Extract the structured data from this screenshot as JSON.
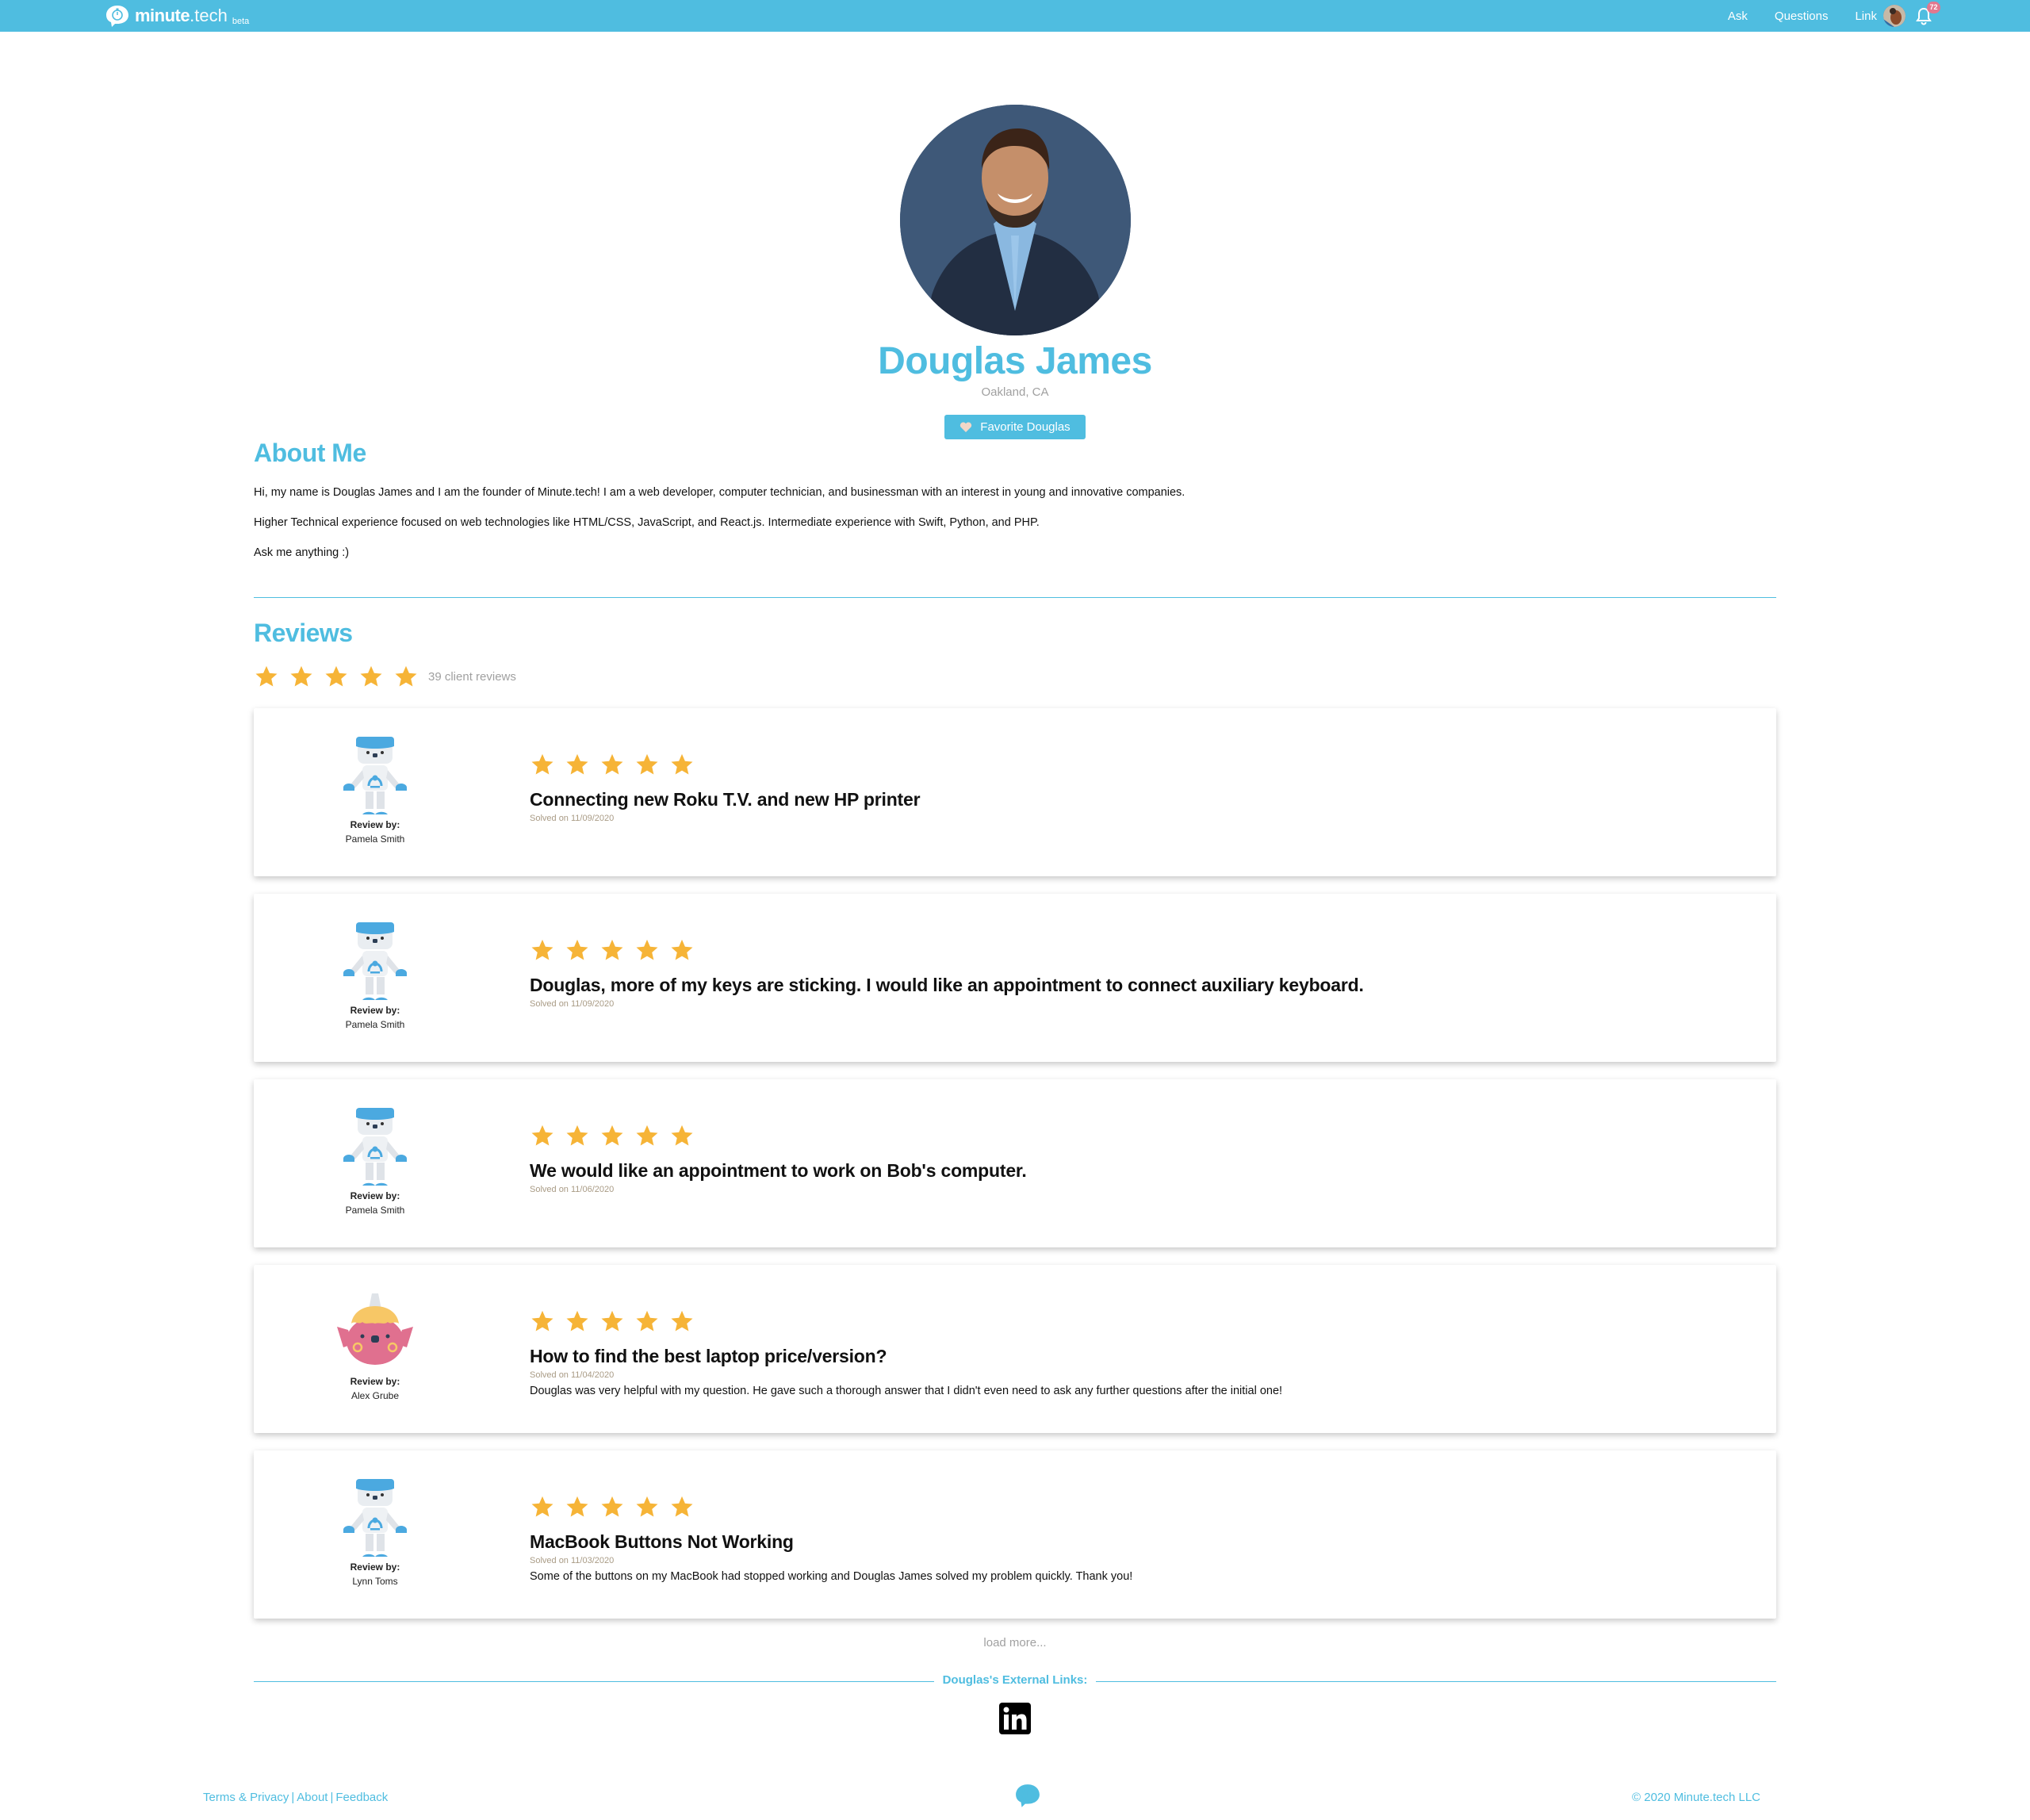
{
  "colors": {
    "brand": "#4fbde0",
    "star": "#f6b437",
    "muted": "#a0a0a0",
    "badge": "#e2788f"
  },
  "navbar": {
    "brand_bold": "minute",
    "brand_light": ".tech",
    "brand_tag": "beta",
    "links": [
      {
        "label": "Ask"
      },
      {
        "label": "Questions"
      },
      {
        "label": "Link"
      }
    ],
    "notification_count": "72",
    "icons": {
      "logo": "brain-stopwatch-icon",
      "avatar": "user-avatar",
      "bell": "bell-icon"
    }
  },
  "profile": {
    "name": "Douglas James",
    "location": "Oakland, CA",
    "favorite_label": "Favorite Douglas",
    "favorite_icon": "heart-icon"
  },
  "about": {
    "title": "About Me",
    "paragraphs": [
      "Hi, my name is Douglas James and I am the founder of Minute.tech! I am a web developer, computer technician, and businessman with an interest in young and innovative companies.",
      "Higher Technical experience focused on web technologies like HTML/CSS, JavaScript, and React.js. Intermediate experience with Swift, Python, and PHP.",
      "Ask me anything :)"
    ]
  },
  "reviews": {
    "title": "Reviews",
    "rating": 5,
    "rating_max": 5,
    "count_label": "39 client reviews",
    "review_by_label": "Review by:",
    "items": [
      {
        "reviewer": "Pamela Smith",
        "avatar": "robot-avatar",
        "rating": 5,
        "title": "Connecting new Roku T.V. and new HP printer",
        "date": "Solved on 11/09/2020",
        "text": ""
      },
      {
        "reviewer": "Pamela Smith",
        "avatar": "robot-avatar",
        "rating": 5,
        "title": "Douglas, more of my keys are sticking. I would like an appointment to connect auxiliary keyboard.",
        "date": "Solved on 11/09/2020",
        "text": ""
      },
      {
        "reviewer": "Pamela Smith",
        "avatar": "robot-avatar",
        "rating": 5,
        "title": "We would like an appointment to work on Bob's computer.",
        "date": "Solved on 11/06/2020",
        "text": ""
      },
      {
        "reviewer": "Alex Grube",
        "avatar": "pink-monster-avatar",
        "rating": 5,
        "title": "How to find the best laptop price/version?",
        "date": "Solved on 11/04/2020",
        "text": "Douglas was very helpful with my question. He gave such a thorough answer that I didn't even need to ask any further questions after the initial one!"
      },
      {
        "reviewer": "Lynn Toms",
        "avatar": "robot-avatar",
        "rating": 5,
        "title": "MacBook Buttons Not Working",
        "date": "Solved on 11/03/2020",
        "text": "Some of the buttons on my MacBook had stopped working and Douglas James solved my problem quickly. Thank you!"
      }
    ],
    "load_more_label": "load more..."
  },
  "external_links": {
    "title": "Douglas's External Links:",
    "items": [
      {
        "name": "LinkedIn",
        "icon": "linkedin-icon"
      }
    ]
  },
  "footer": {
    "links": [
      {
        "label": "Terms & Privacy"
      },
      {
        "label": "About"
      },
      {
        "label": "Feedback"
      }
    ],
    "separator": "|",
    "copyright": "© 2020 Minute.tech LLC"
  }
}
